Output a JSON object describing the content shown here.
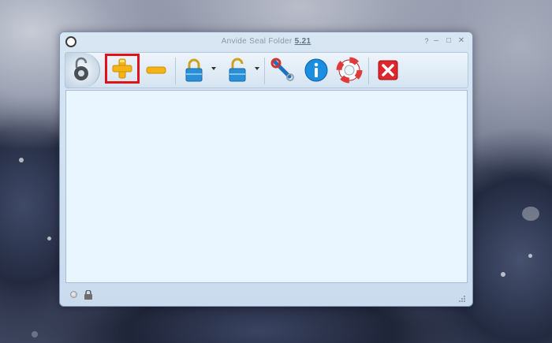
{
  "window": {
    "title_main": "Anvide Seal Folder",
    "title_version": "5.21",
    "controls": {
      "help": "?",
      "minimize": "–",
      "maximize": "□",
      "close": "✕"
    }
  },
  "toolbar": {
    "buttons": [
      {
        "name": "add-folder-button",
        "icon": "plus-icon",
        "color": "#f5b416",
        "selected": true
      },
      {
        "name": "remove-folder-button",
        "icon": "minus-icon",
        "color": "#f5b416"
      },
      {
        "name": "close-access-button",
        "icon": "locked-padlock-icon",
        "color": "#2a8fd6",
        "dropdown": true
      },
      {
        "name": "open-access-button",
        "icon": "unlocked-padlock-icon",
        "color": "#2a8fd6",
        "dropdown": true
      },
      {
        "name": "settings-button",
        "icon": "wrench-icon",
        "color": "#1e70c0"
      },
      {
        "name": "about-button",
        "icon": "info-icon",
        "color": "#1a8ee0"
      },
      {
        "name": "help-button",
        "icon": "lifebuoy-icon",
        "color": "#e03b3b"
      },
      {
        "name": "exit-button",
        "icon": "red-x-icon",
        "color": "#e0262d"
      }
    ]
  },
  "folder_list": {
    "items": []
  },
  "statusbar": {
    "indicator": "status-dot-icon",
    "lock_state": "lock-icon"
  },
  "colors": {
    "highlight": "#e2121b",
    "list_background": "#eaf6ff",
    "window_frame": "#c9dbed"
  }
}
